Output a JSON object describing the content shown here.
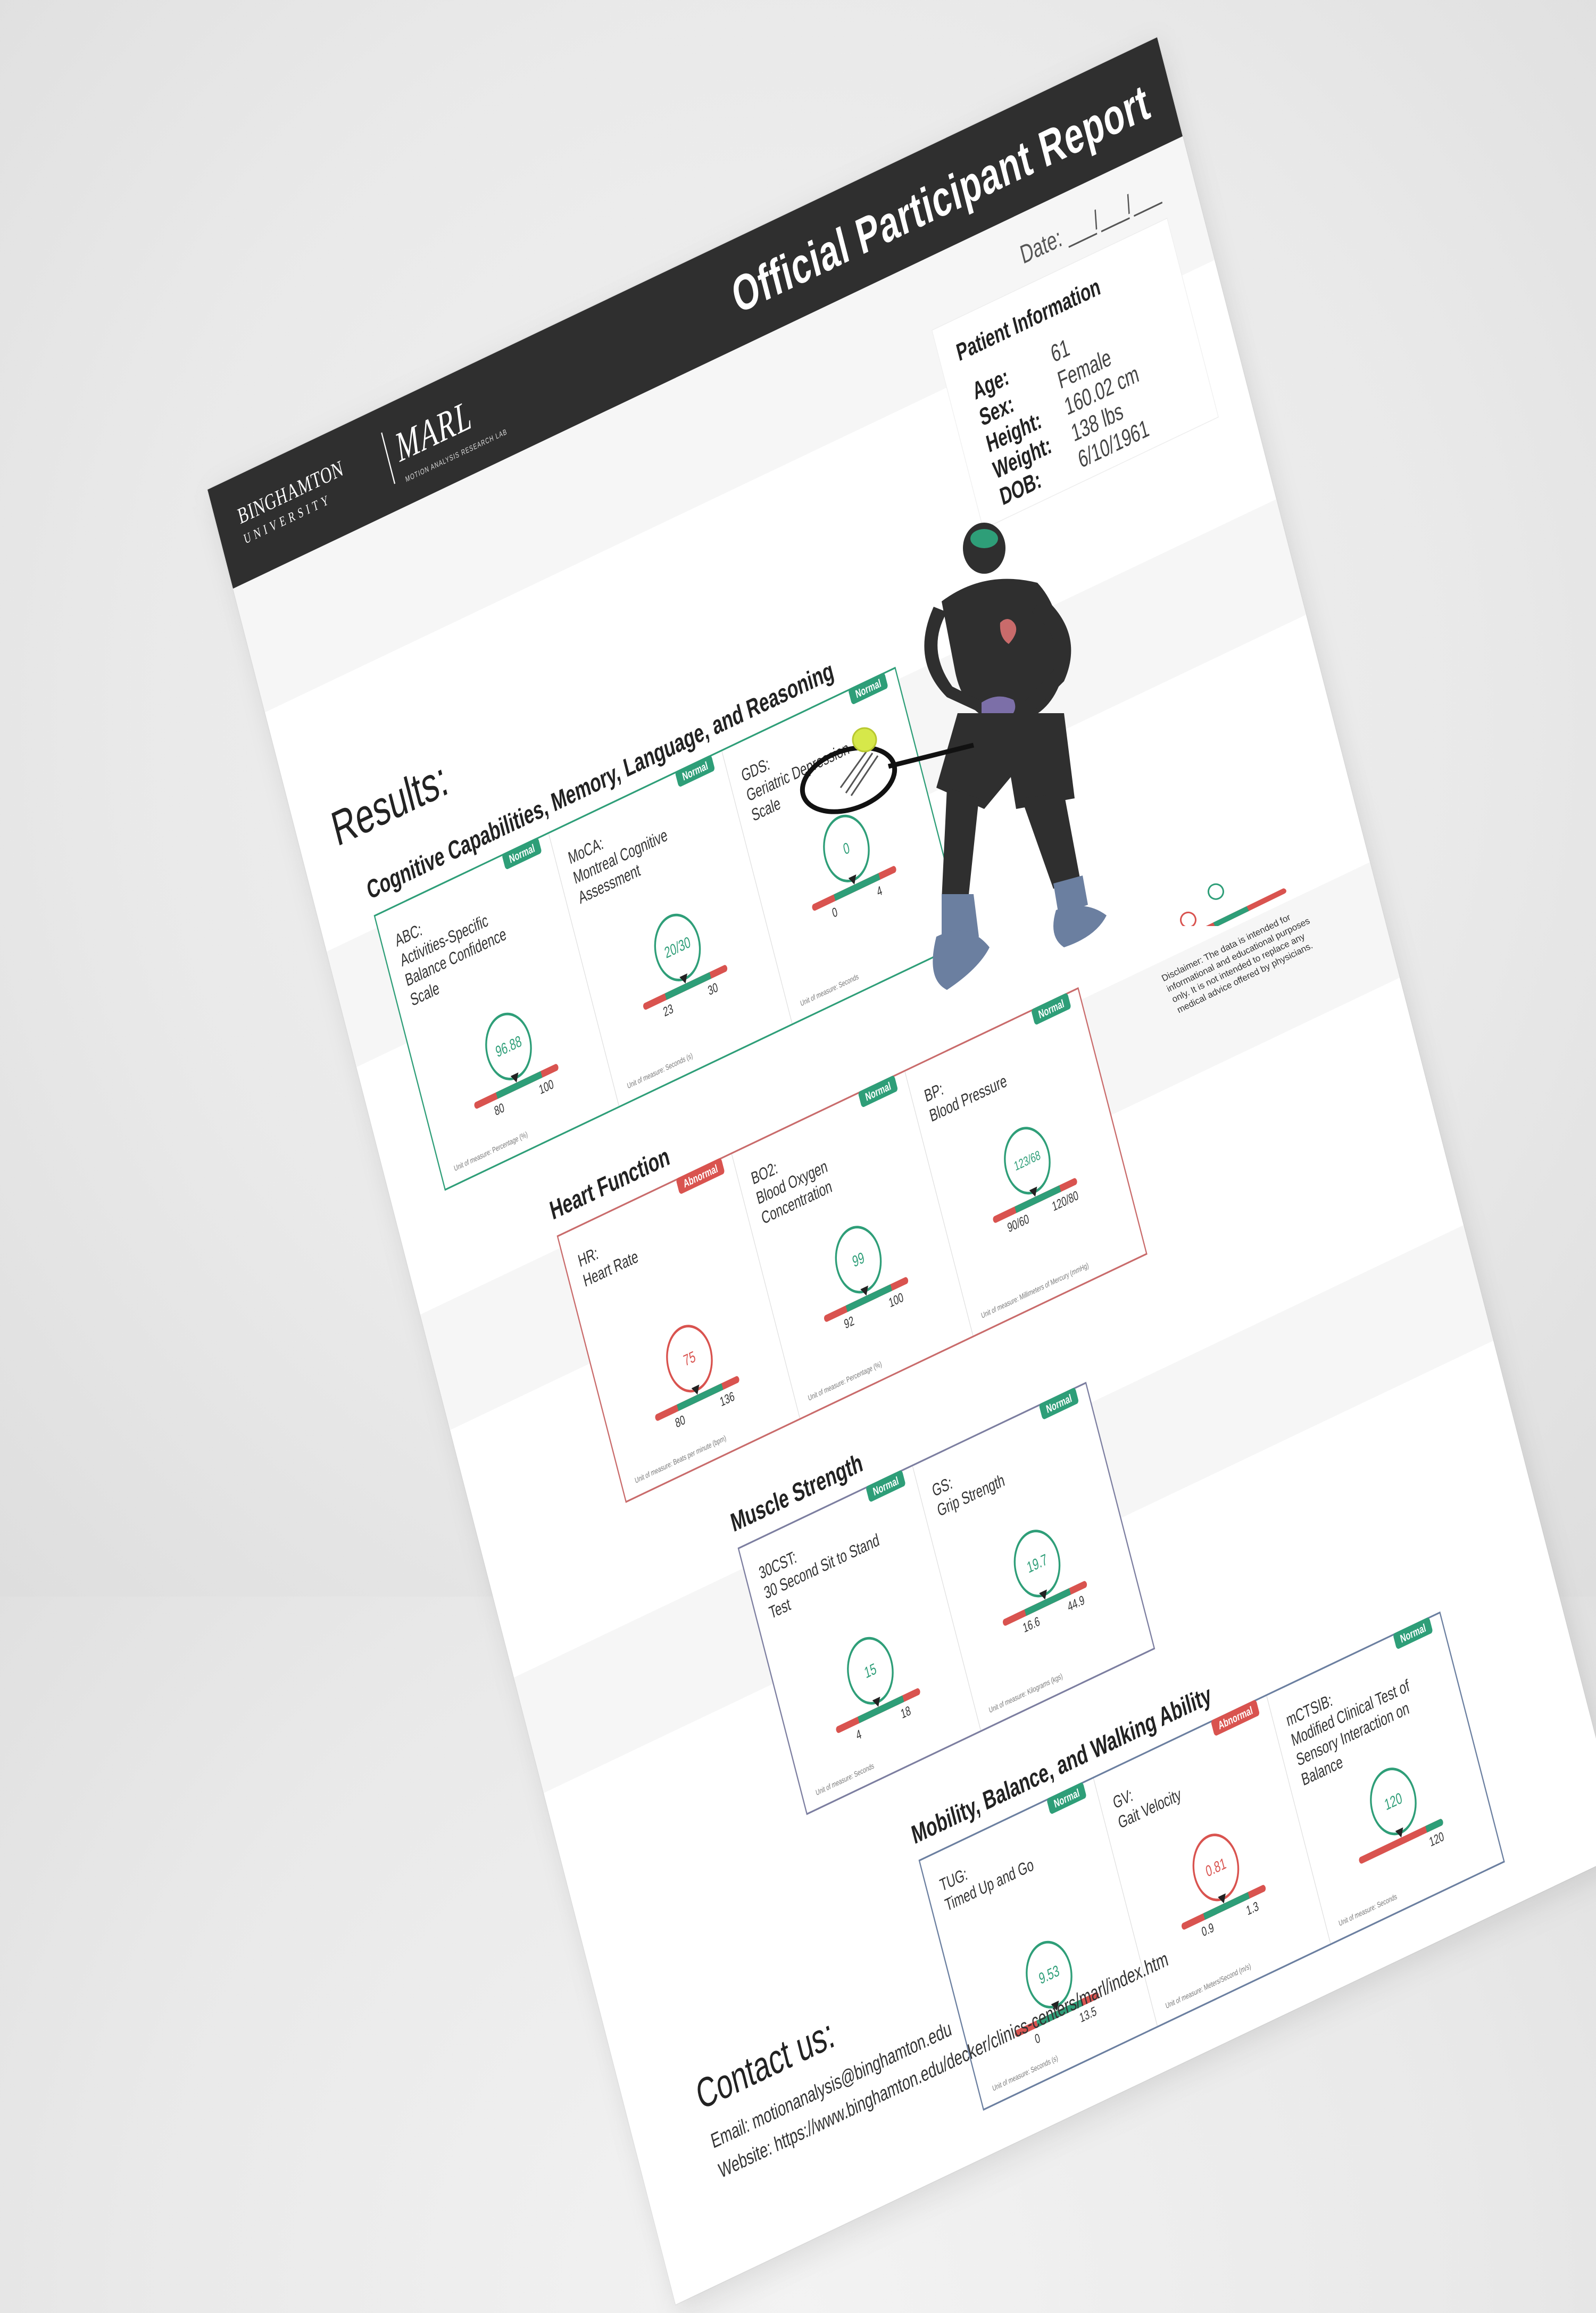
{
  "header": {
    "logo_bu_line1": "BINGHAMTON",
    "logo_bu_line2": "UNIVERSITY",
    "logo_marl": "MARL",
    "logo_marl_sub": "MOTION ANALYSIS RESEARCH LAB",
    "title": "Official Participant Report"
  },
  "date_label": "Date: ___/___/___",
  "patient": {
    "title": "Patient Information",
    "rows": [
      {
        "key": "Age:",
        "value": "61"
      },
      {
        "key": "Sex:",
        "value": "Female"
      },
      {
        "key": "Height:",
        "value": "160.02 cm"
      },
      {
        "key": "Weight:",
        "value": "138 lbs"
      },
      {
        "key": "DOB:",
        "value": "6/10/1961"
      }
    ]
  },
  "results_title": "Results:",
  "sections": {
    "cognitive": {
      "title": "Cognitive Capabilities, Memory, Language, and Reasoning",
      "color": "#2e9e78",
      "cells": [
        {
          "name": "ABC:\nActivities-Specific\nBalance Confidence\nScale",
          "status": "Normal",
          "value": "96.88",
          "lo": "80",
          "hi": "100",
          "unit": "Unit of measure: Percentage (%)"
        },
        {
          "name": "MoCA:\nMontreal Cognitive\nAssessment",
          "status": "Normal",
          "value": "20/30",
          "lo": "23",
          "hi": "30",
          "unit": "Unit of measure: Seconds (s)"
        },
        {
          "name": "GDS:\nGeriatric Depression\nScale",
          "status": "Normal",
          "value": "0",
          "lo": "0",
          "hi": "4",
          "unit": "Unit of measure: Seconds"
        }
      ]
    },
    "heart": {
      "title": "Heart Function",
      "color": "#c96b6b",
      "cells": [
        {
          "name": "HR:\nHeart Rate",
          "status": "Abnormal",
          "value": "75",
          "lo": "80",
          "hi": "136",
          "unit": "Unit of measure: Beats per minute (bpm)"
        },
        {
          "name": "BO2:\nBlood Oxygen\nConcentration",
          "status": "Normal",
          "value": "99",
          "lo": "92",
          "hi": "100",
          "unit": "Unit of measure: Percentage (%)"
        },
        {
          "name": "BP:\nBlood Pressure",
          "status": "Normal",
          "value": "123/68",
          "lo": "90/60",
          "hi": "120/80",
          "unit": "Unit of measure: Millimeters of Mercury (mmHg)"
        }
      ]
    },
    "muscle": {
      "title": "Muscle Strength",
      "color": "#7c7ea0",
      "cells": [
        {
          "name": "30CST:\n30 Second Sit to Stand\nTest",
          "status": "Normal",
          "value": "15",
          "lo": "4",
          "hi": "18",
          "unit": "Unit of measure: Seconds"
        },
        {
          "name": "GS:\nGrip Strength",
          "status": "Normal",
          "value": "19.7",
          "lo": "16.6",
          "hi": "44.9",
          "unit": "Unit of measure: Kilograms (kgs)"
        }
      ]
    },
    "mobility": {
      "title": "Mobility, Balance, and Walking Ability",
      "color": "#6b7fa0",
      "cells": [
        {
          "name": "TUG:\nTimed Up and Go",
          "status": "Normal",
          "value": "9.53",
          "lo": "0",
          "hi": "13.5",
          "unit": "Unit of measure: Seconds (s)"
        },
        {
          "name": "GV:\nGait Velocity",
          "status": "Abnormal",
          "value": "0.81",
          "lo": "0.9",
          "hi": "1.3",
          "unit": "Unit of measure: Meters/Second (m/s)"
        },
        {
          "name": "mCTSIB:\nModified Clinical Test of\nSensory Interaction on\nBalance",
          "status": "Normal",
          "value": "120",
          "lo": "",
          "hi": "120",
          "unit": "Unit of measure: Seconds"
        }
      ]
    }
  },
  "disclaimer": "Disclaimer: The data is intended for informational and educational purposes only. It is not intended to replace any medical advice offered by physicians.",
  "contact": {
    "title": "Contact us:",
    "email": "Email: motionanalysis@binghamton.edu",
    "website": "Website: https://www.binghamton.edu/decker/clinics-centers/marl/index.htm"
  },
  "colors": {
    "normal": "#2e9e78",
    "abnormal": "#d9534f",
    "header": "#2f2f2f"
  }
}
